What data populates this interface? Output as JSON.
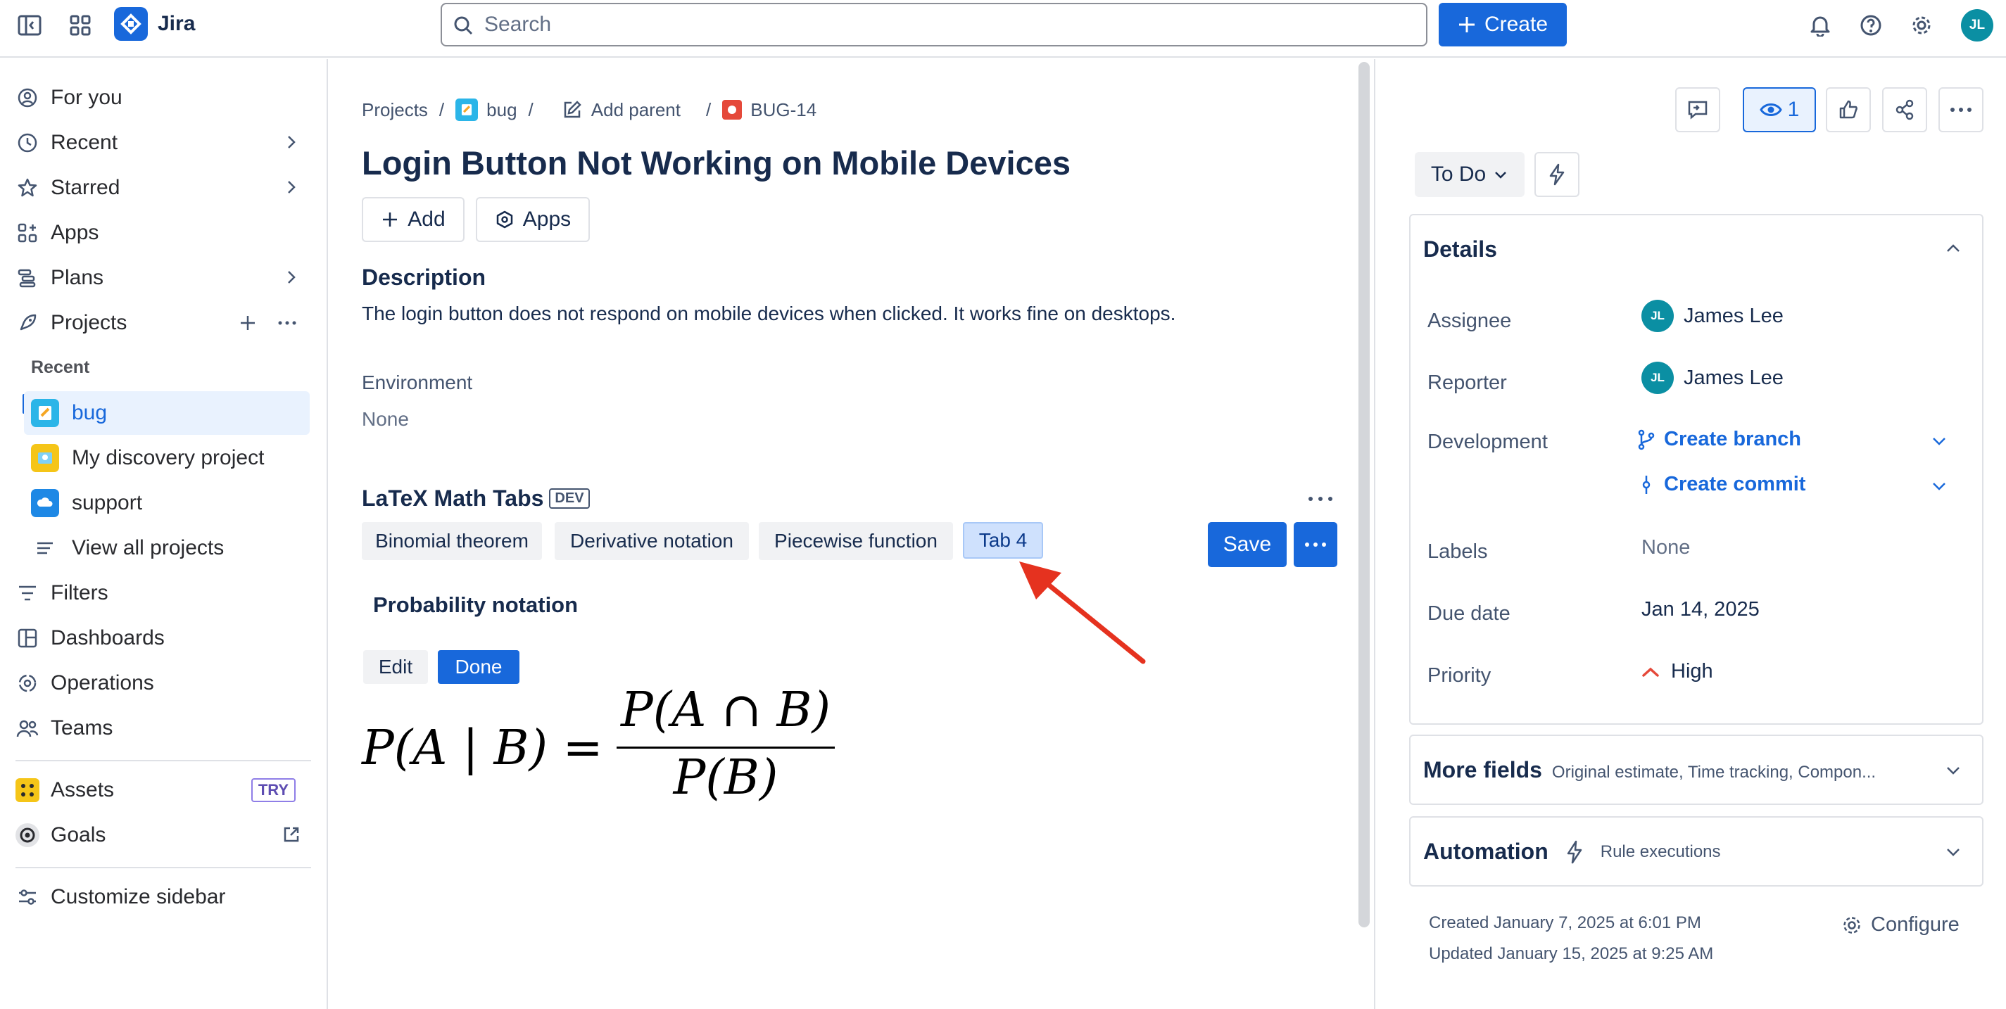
{
  "app": {
    "name": "Jira"
  },
  "search": {
    "placeholder": "Search"
  },
  "create": {
    "label": "Create"
  },
  "user": {
    "initials": "JL"
  },
  "sidebar": {
    "for_you": "For you",
    "recent": "Recent",
    "starred": "Starred",
    "apps": "Apps",
    "plans": "Plans",
    "projects": "Projects",
    "recent_section": "Recent",
    "project_items": [
      "bug",
      "My discovery project",
      "support"
    ],
    "view_all": "View all projects",
    "filters": "Filters",
    "dashboards": "Dashboards",
    "operations": "Operations",
    "teams": "Teams",
    "assets": "Assets",
    "try_badge": "TRY",
    "goals": "Goals",
    "customize": "Customize sidebar"
  },
  "breadcrumb": {
    "projects": "Projects",
    "bug": "bug",
    "add_parent": "Add parent",
    "issue_key": "BUG-14"
  },
  "issue": {
    "title": "Login Button Not Working on Mobile Devices",
    "add_label": "Add",
    "apps_label": "Apps",
    "description_heading": "Description",
    "description": "The login button does not respond on mobile devices when clicked. It works fine on desktops.",
    "environment_label": "Environment",
    "environment_value": "None"
  },
  "latex": {
    "title": "LaTeX Math Tabs",
    "badge": "DEV",
    "tabs": [
      "Binomial theorem",
      "Derivative notation",
      "Piecewise function",
      "Tab 4"
    ],
    "save": "Save",
    "section_title": "Probability notation",
    "edit": "Edit",
    "done": "Done",
    "formula_lhs": "P(A | B) =",
    "formula_num": "P(A ∩ B)",
    "formula_den": "P(B)"
  },
  "right": {
    "watch_count": "1",
    "status": "To Do",
    "details_heading": "Details",
    "assignee_label": "Assignee",
    "assignee": "James Lee",
    "reporter_label": "Reporter",
    "reporter": "James Lee",
    "development_label": "Development",
    "create_branch": "Create branch",
    "create_commit": "Create commit",
    "labels_label": "Labels",
    "labels_value": "None",
    "due_label": "Due date",
    "due_value": "Jan 14, 2025",
    "priority_label": "Priority",
    "priority_value": "High",
    "more_fields": "More fields",
    "more_fields_hint": "Original estimate, Time tracking, Compon...",
    "automation": "Automation",
    "rule_exec": "Rule executions",
    "created": "Created January 7, 2025 at 6:01 PM",
    "updated": "Updated January 15, 2025 at 9:25 AM",
    "configure": "Configure"
  },
  "colors": {
    "accent": "#1868db",
    "annotation_arrow": "#e5321f",
    "priority_high": "#e5493a"
  }
}
